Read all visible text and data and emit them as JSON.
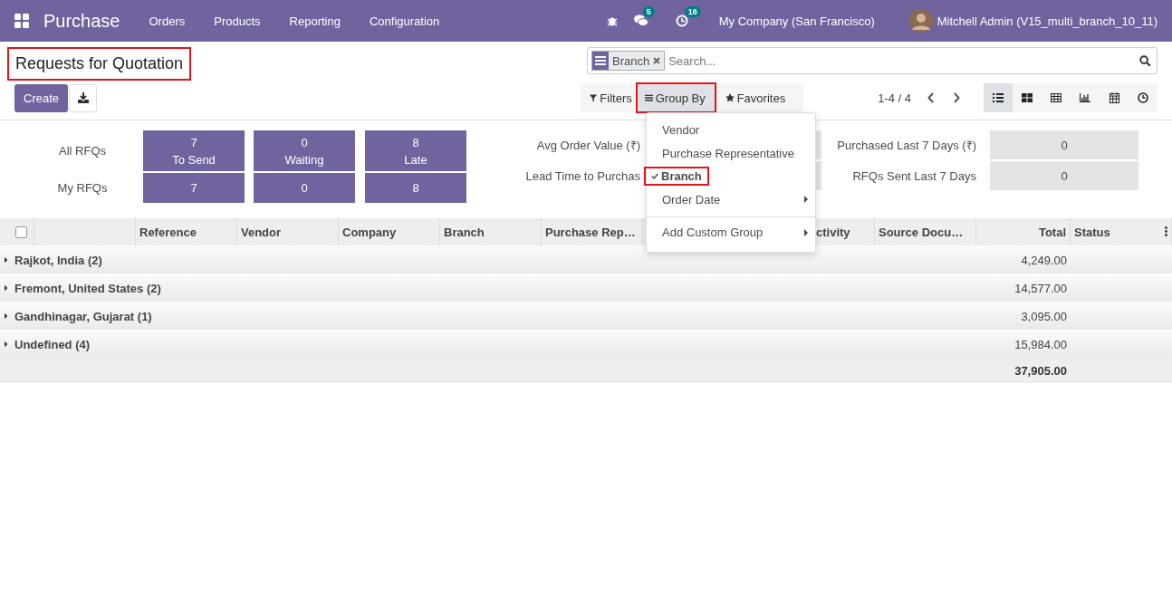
{
  "navbar": {
    "app_name": "Purchase",
    "menu": [
      "Orders",
      "Products",
      "Reporting",
      "Configuration"
    ],
    "messages_badge": "5",
    "activities_badge": "16",
    "company": "My Company (San Francisco)",
    "user": "Mitchell Admin (V15_multi_branch_10_11)"
  },
  "title": {
    "text": "Requests for Quotation",
    "highlighted": true
  },
  "create_button": "Create",
  "search": {
    "facets": [
      {
        "label": "Branch"
      }
    ],
    "placeholder": "Search..."
  },
  "search_options": [
    {
      "label": "Filters",
      "kind": "filter",
      "selected": false,
      "highlighted": false
    },
    {
      "label": "Group By",
      "kind": "group",
      "selected": true,
      "highlighted": true
    },
    {
      "label": "Favorites",
      "kind": "star",
      "selected": false,
      "highlighted": false
    }
  ],
  "pager": "1-4 / 4",
  "views": [
    {
      "kind": "list",
      "selected": true
    },
    {
      "kind": "kanban",
      "selected": false
    },
    {
      "kind": "pivot",
      "selected": false
    },
    {
      "kind": "graph",
      "selected": false
    },
    {
      "kind": "calendar",
      "selected": false
    },
    {
      "kind": "activity",
      "selected": false
    }
  ],
  "group_by_menu": {
    "items": [
      {
        "label": "Vendor",
        "checked": false,
        "submenu": false,
        "highlighted": false
      },
      {
        "label": "Purchase Representative",
        "checked": false,
        "submenu": false,
        "highlighted": false
      },
      {
        "label": "Branch",
        "checked": true,
        "submenu": false,
        "highlighted": true
      },
      {
        "label": "Order Date",
        "checked": false,
        "submenu": true,
        "highlighted": false
      }
    ],
    "custom": "Add Custom Group"
  },
  "dashboard": {
    "row_labels": [
      "All RFQs",
      "My RFQs"
    ],
    "tiles": [
      {
        "all": "7",
        "label": "To Send",
        "my": "7"
      },
      {
        "all": "0",
        "label": "Waiting",
        "my": "0"
      },
      {
        "all": "8",
        "label": "Late",
        "my": "8"
      }
    ],
    "stats_left": [
      {
        "label": "Avg Order Value (₹)"
      },
      {
        "label": "Lead Time to Purchas"
      }
    ],
    "stats_right": [
      {
        "label": "Purchased Last 7 Days (₹)",
        "value": "0"
      },
      {
        "label": "RFQs Sent Last 7 Days",
        "value": "0"
      }
    ]
  },
  "table": {
    "select_all": {
      "checked": false
    },
    "columns": [
      {
        "label": "Reference",
        "numeric": false
      },
      {
        "label": "Vendor",
        "numeric": false
      },
      {
        "label": "Company",
        "numeric": false
      },
      {
        "label": "Branch",
        "numeric": false
      },
      {
        "label": "Purchase Rep…",
        "numeric": false
      },
      {
        "label": "ctivity",
        "numeric": false
      },
      {
        "label": "Source Docu…",
        "numeric": false
      },
      {
        "label": "Total",
        "numeric": true
      },
      {
        "label": "Status",
        "numeric": false
      }
    ],
    "groups": [
      {
        "label": "Rajkot, India (2)",
        "total": "4,249.00",
        "expanded": false
      },
      {
        "label": "Fremont, United States (2)",
        "total": "14,577.00",
        "expanded": false
      },
      {
        "label": "Gandhinagar, Gujarat (1)",
        "total": "3,095.00",
        "expanded": false
      },
      {
        "label": "Undefined (4)",
        "total": "15,984.00",
        "expanded": false
      }
    ],
    "grand_total": "37,905.00"
  }
}
